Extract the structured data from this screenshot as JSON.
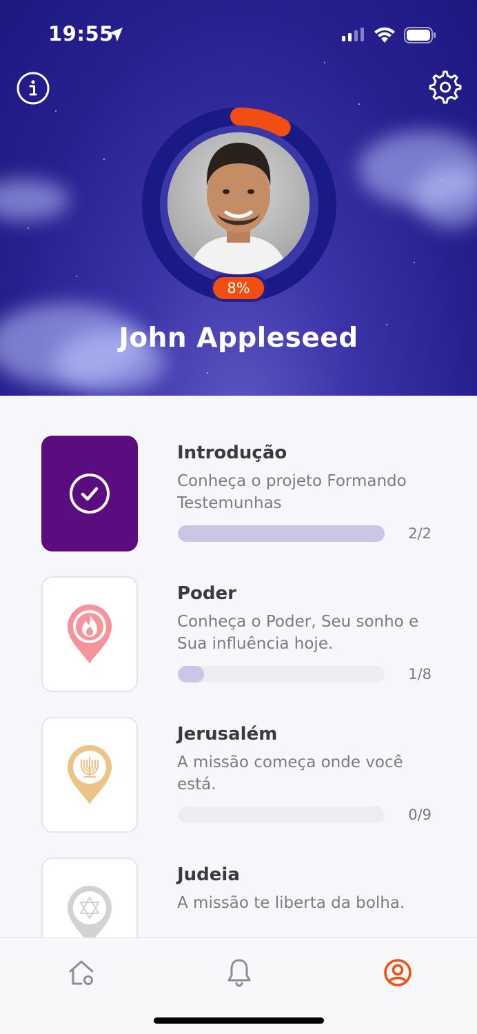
{
  "status_bar": {
    "time": "19:55"
  },
  "profile": {
    "name": "John Appleseed",
    "progress_label": "8%",
    "progress_fraction": 0.08
  },
  "modules": [
    {
      "title": "Introdução",
      "description": "Conheça o projeto Formando Testemunhas",
      "count": "2/2",
      "progress": 1.0,
      "icon": "check-circle-icon",
      "completed": true
    },
    {
      "title": "Poder",
      "description": "Conheça o Poder, Seu sonho e Sua influência hoje.",
      "count": "1/8",
      "progress": 0.125,
      "icon": "fire-pin-icon",
      "completed": false
    },
    {
      "title": "Jerusalém",
      "description": "A missão começa onde você está.",
      "count": "0/9",
      "progress": 0,
      "icon": "menorah-pin-icon",
      "completed": false
    },
    {
      "title": "Judeia",
      "description": "A missão te liberta da bolha.",
      "count": "",
      "progress": 0,
      "icon": "star-of-david-pin-icon",
      "completed": false
    }
  ],
  "tabs": [
    {
      "name": "home",
      "icon": "home-icon",
      "active": false
    },
    {
      "name": "notifications",
      "icon": "bell-icon",
      "active": false
    },
    {
      "name": "profile",
      "icon": "user-circle-icon",
      "active": true
    }
  ],
  "colors": {
    "accent": "#f04e12",
    "completed_tile": "#5b0c7e",
    "progress_fill": "#cbc5e6",
    "pin_red": "#f7939b",
    "pin_gold": "#ecc487",
    "pin_gray": "#d3d3d3"
  }
}
